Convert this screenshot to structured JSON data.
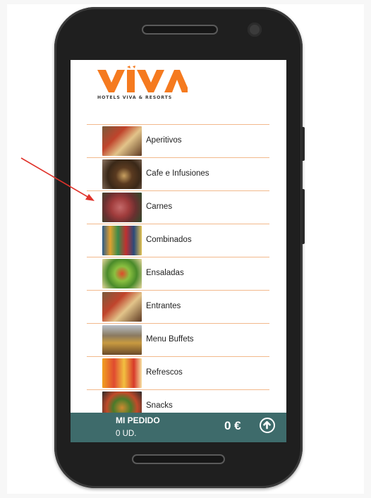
{
  "brand": {
    "logo_text": "VIVA",
    "tagline": "HOTELS VIVA & RESORTS",
    "accent_color": "#f57a1f"
  },
  "menu": {
    "items": [
      {
        "label": "Aperitivos",
        "thumb": "appetizers-photo"
      },
      {
        "label": "Cafe e Infusiones",
        "thumb": "coffee-photo"
      },
      {
        "label": "Carnes",
        "thumb": "meat-photo"
      },
      {
        "label": "Combinados",
        "thumb": "cocktails-photo"
      },
      {
        "label": "Ensaladas",
        "thumb": "salad-photo"
      },
      {
        "label": "Entrantes",
        "thumb": "starters-photo"
      },
      {
        "label": "Menu Buffets",
        "thumb": "buffet-photo"
      },
      {
        "label": "Refrescos",
        "thumb": "soft-drinks-photo"
      },
      {
        "label": "Snacks",
        "thumb": "snacks-photo"
      }
    ],
    "divider_color": "#f2b98c"
  },
  "order": {
    "title": "MI PEDIDO",
    "units": "0 UD.",
    "total": "0 €",
    "footer_color": "#3e6b6b"
  },
  "annotation": {
    "arrow_color": "#e0332b",
    "points_to": "Carnes"
  },
  "icons": {
    "order_button": "arrow-up-circle-icon"
  }
}
